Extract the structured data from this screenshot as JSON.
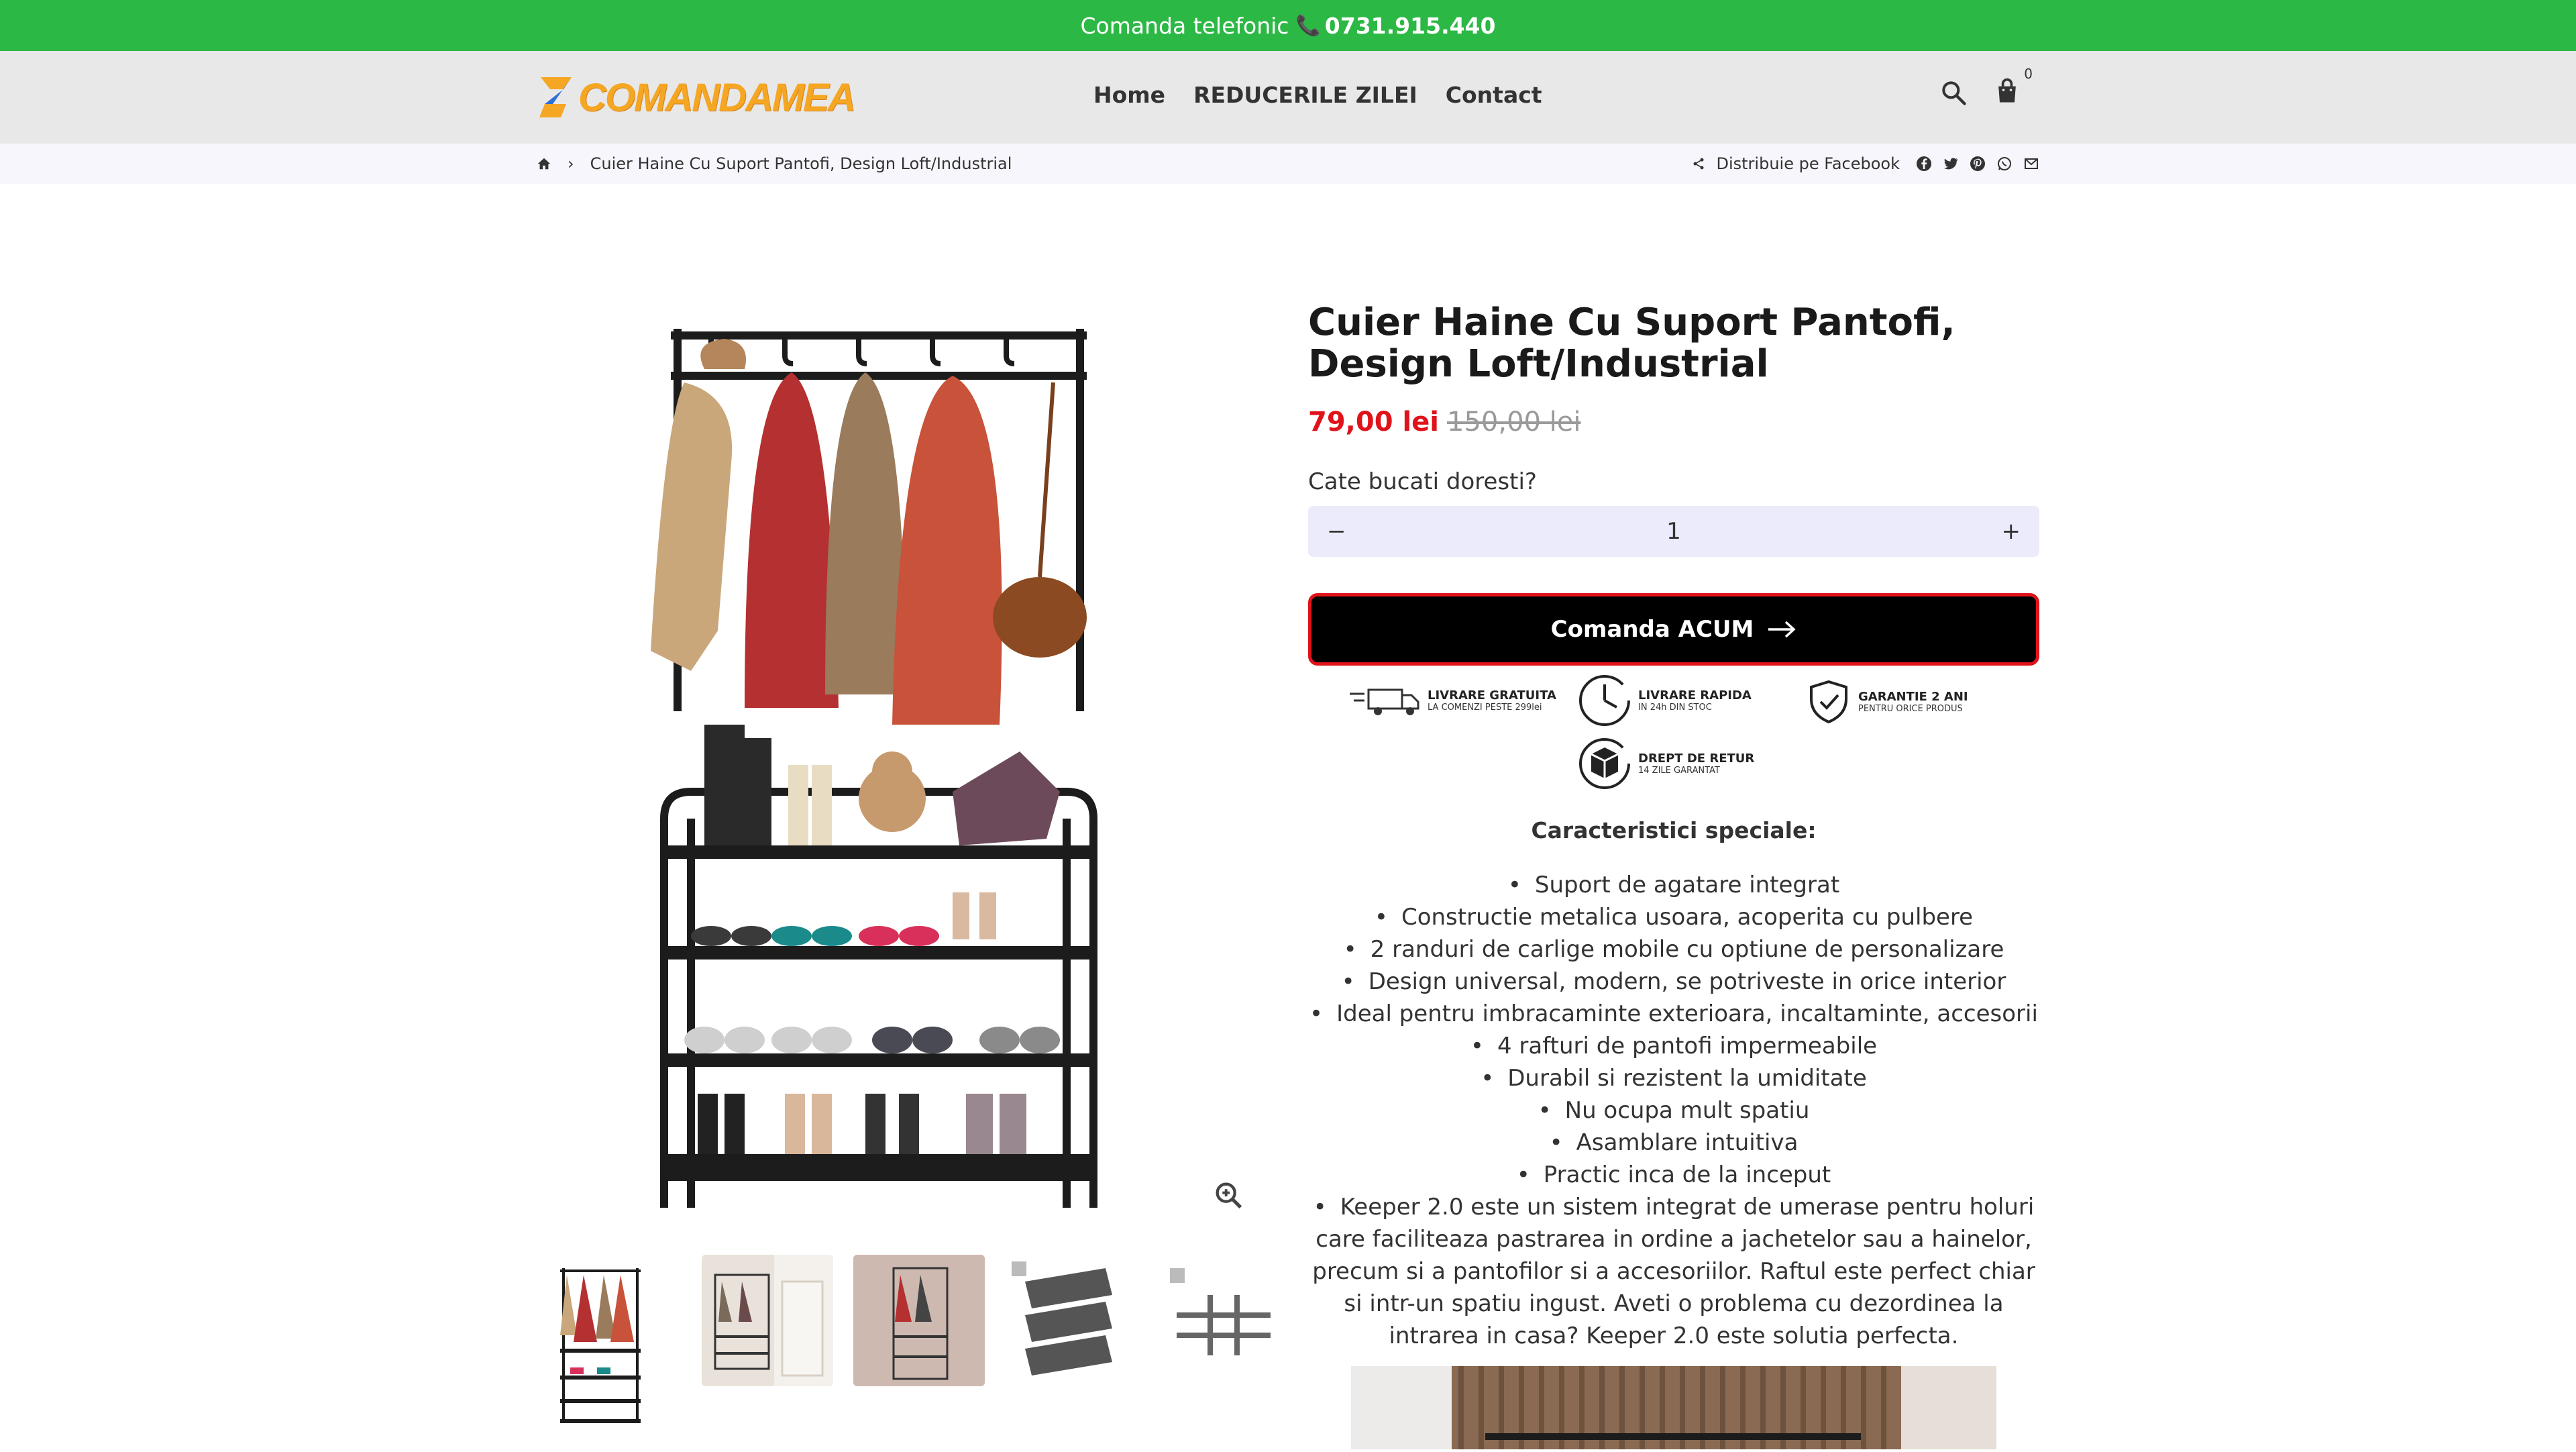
{
  "topbar": {
    "text": "Comanda telefonic",
    "phone": "0731.915.440"
  },
  "header": {
    "logo_text": "COMANDAMEA",
    "nav": [
      {
        "label": "Home"
      },
      {
        "label": "REDUCERILE ZILEI"
      },
      {
        "label": "Contact"
      }
    ],
    "cart_count": "0"
  },
  "breadcrumb": {
    "separator": "›",
    "current": "Cuier Haine Cu Suport Pantofi, Design Loft/Industrial",
    "share_label": "Distribuie pe Facebook"
  },
  "product": {
    "title": "Cuier Haine Cu Suport Pantofi, Design Loft/Industrial",
    "price_now": "79,00 lei",
    "price_old": "150,00 lei",
    "qty_label": "Cate bucati doresti?",
    "qty_value": "1",
    "qty_minus": "−",
    "qty_plus": "+",
    "order_label": "Comanda ACUM"
  },
  "badges": [
    {
      "title": "LIVRARE GRATUITA",
      "sub": "LA COMENZI PESTE 299lei"
    },
    {
      "title": "LIVRARE RAPIDA",
      "sub": "IN 24h DIN STOC"
    },
    {
      "title": "GARANTIE 2 ANI",
      "sub": "PENTRU ORICE PRODUS"
    },
    {
      "title": "DREPT DE RETUR",
      "sub": "14 ZILE GARANTAT"
    }
  ],
  "features": {
    "title": "Caracteristici speciale:",
    "items": [
      "Suport de agatare integrat",
      "Constructie metalica usoara, acoperita cu pulbere",
      "2 randuri de carlige mobile cu optiune de personalizare",
      "Design universal, modern, se potriveste in orice interior",
      "Ideal pentru imbracaminte exterioara, incaltaminte, accesorii",
      "4 rafturi de pantofi impermeabile",
      "Durabil si rezistent la umiditate",
      "Nu ocupa mult spatiu",
      "Asamblare intuitiva",
      "Practic inca de la inceput",
      "Keeper 2.0 este un sistem integrat de umerase pentru holuri care faciliteaza pastrarea in ordine a jachetelor sau a hainelor, precum si a pantofilor si a accesoriilor. Raftul este perfect chiar si intr-un spatiu ingust. Aveti o problema cu dezordinea la intrarea in casa? Keeper 2.0 este solutia perfecta."
    ]
  },
  "colors": {
    "topbar": "#2cb845",
    "header": "#e8e8e8",
    "price": "#e0121a",
    "button": "#000000",
    "button_border": "#e0121a",
    "qty_bg": "#ecebfb"
  }
}
